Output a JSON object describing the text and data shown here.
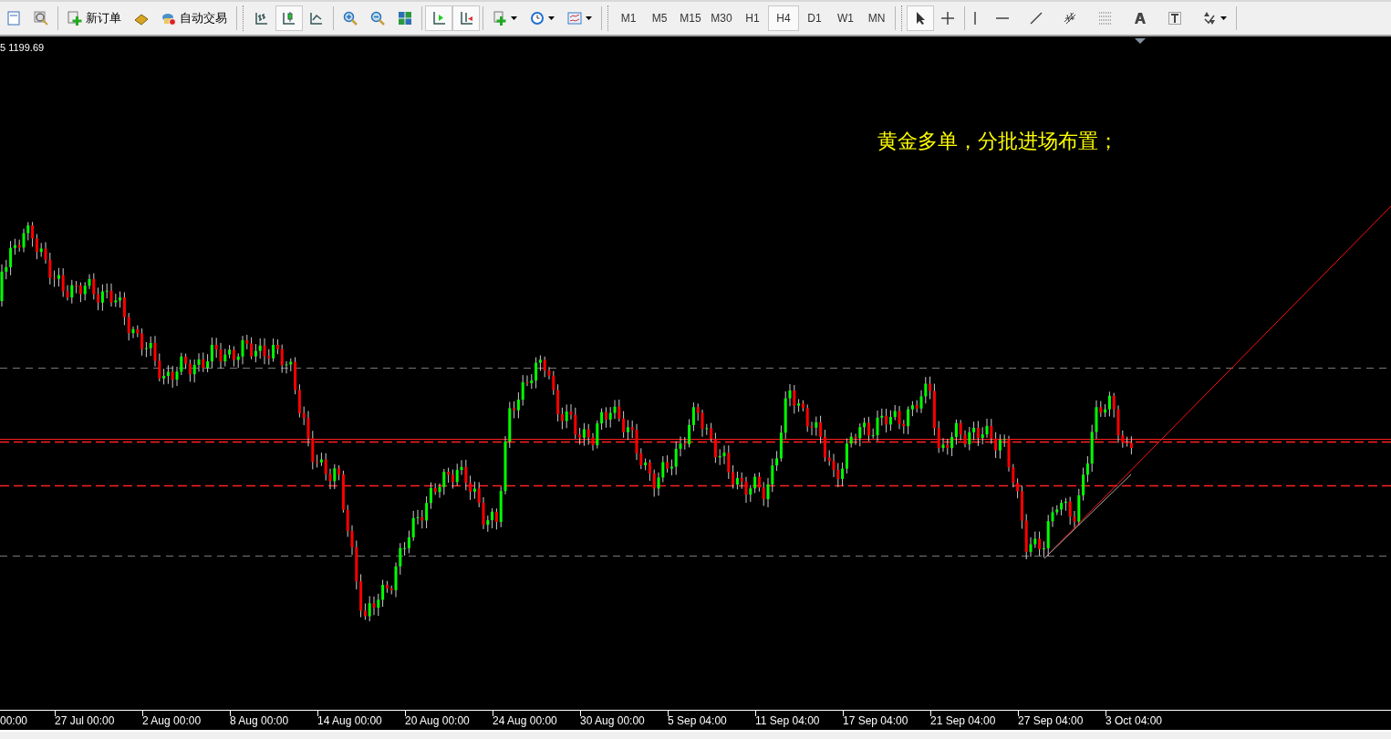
{
  "toolbar": {
    "new_order": {
      "label": "新订单"
    },
    "auto_trading": {
      "label": "自动交易"
    },
    "chart_modes": [
      {
        "selected": false
      },
      {
        "selected": true
      },
      {
        "selected": false
      }
    ],
    "scroll_modes": [
      {
        "selected": true
      },
      {
        "selected": true
      }
    ],
    "timeframes": [
      {
        "label": "M1",
        "selected": false
      },
      {
        "label": "M5",
        "selected": false
      },
      {
        "label": "M15",
        "selected": false
      },
      {
        "label": "M30",
        "selected": false
      },
      {
        "label": "H1",
        "selected": false
      },
      {
        "label": "H4",
        "selected": true
      },
      {
        "label": "D1",
        "selected": false
      },
      {
        "label": "W1",
        "selected": false
      },
      {
        "label": "MN",
        "selected": false
      }
    ],
    "cursor_tools": [
      {
        "selected": true
      },
      {
        "selected": false
      }
    ]
  },
  "chart": {
    "price_label": "5 1199.69",
    "annotation": "黄金多单，分批进场布置；",
    "x_axis_labels": [
      "00:00",
      "27 Jul 00:00",
      "2 Aug 00:00",
      "8 Aug 00:00",
      "14 Aug 00:00",
      "20 Aug 00:00",
      "24 Aug 00:00",
      "30 Aug 00:00",
      "5 Sep 04:00",
      "11 Sep 04:00",
      "17 Sep 04:00",
      "21 Sep 04:00",
      "27 Sep 04:00",
      "3 Oct 04:00"
    ]
  }
}
